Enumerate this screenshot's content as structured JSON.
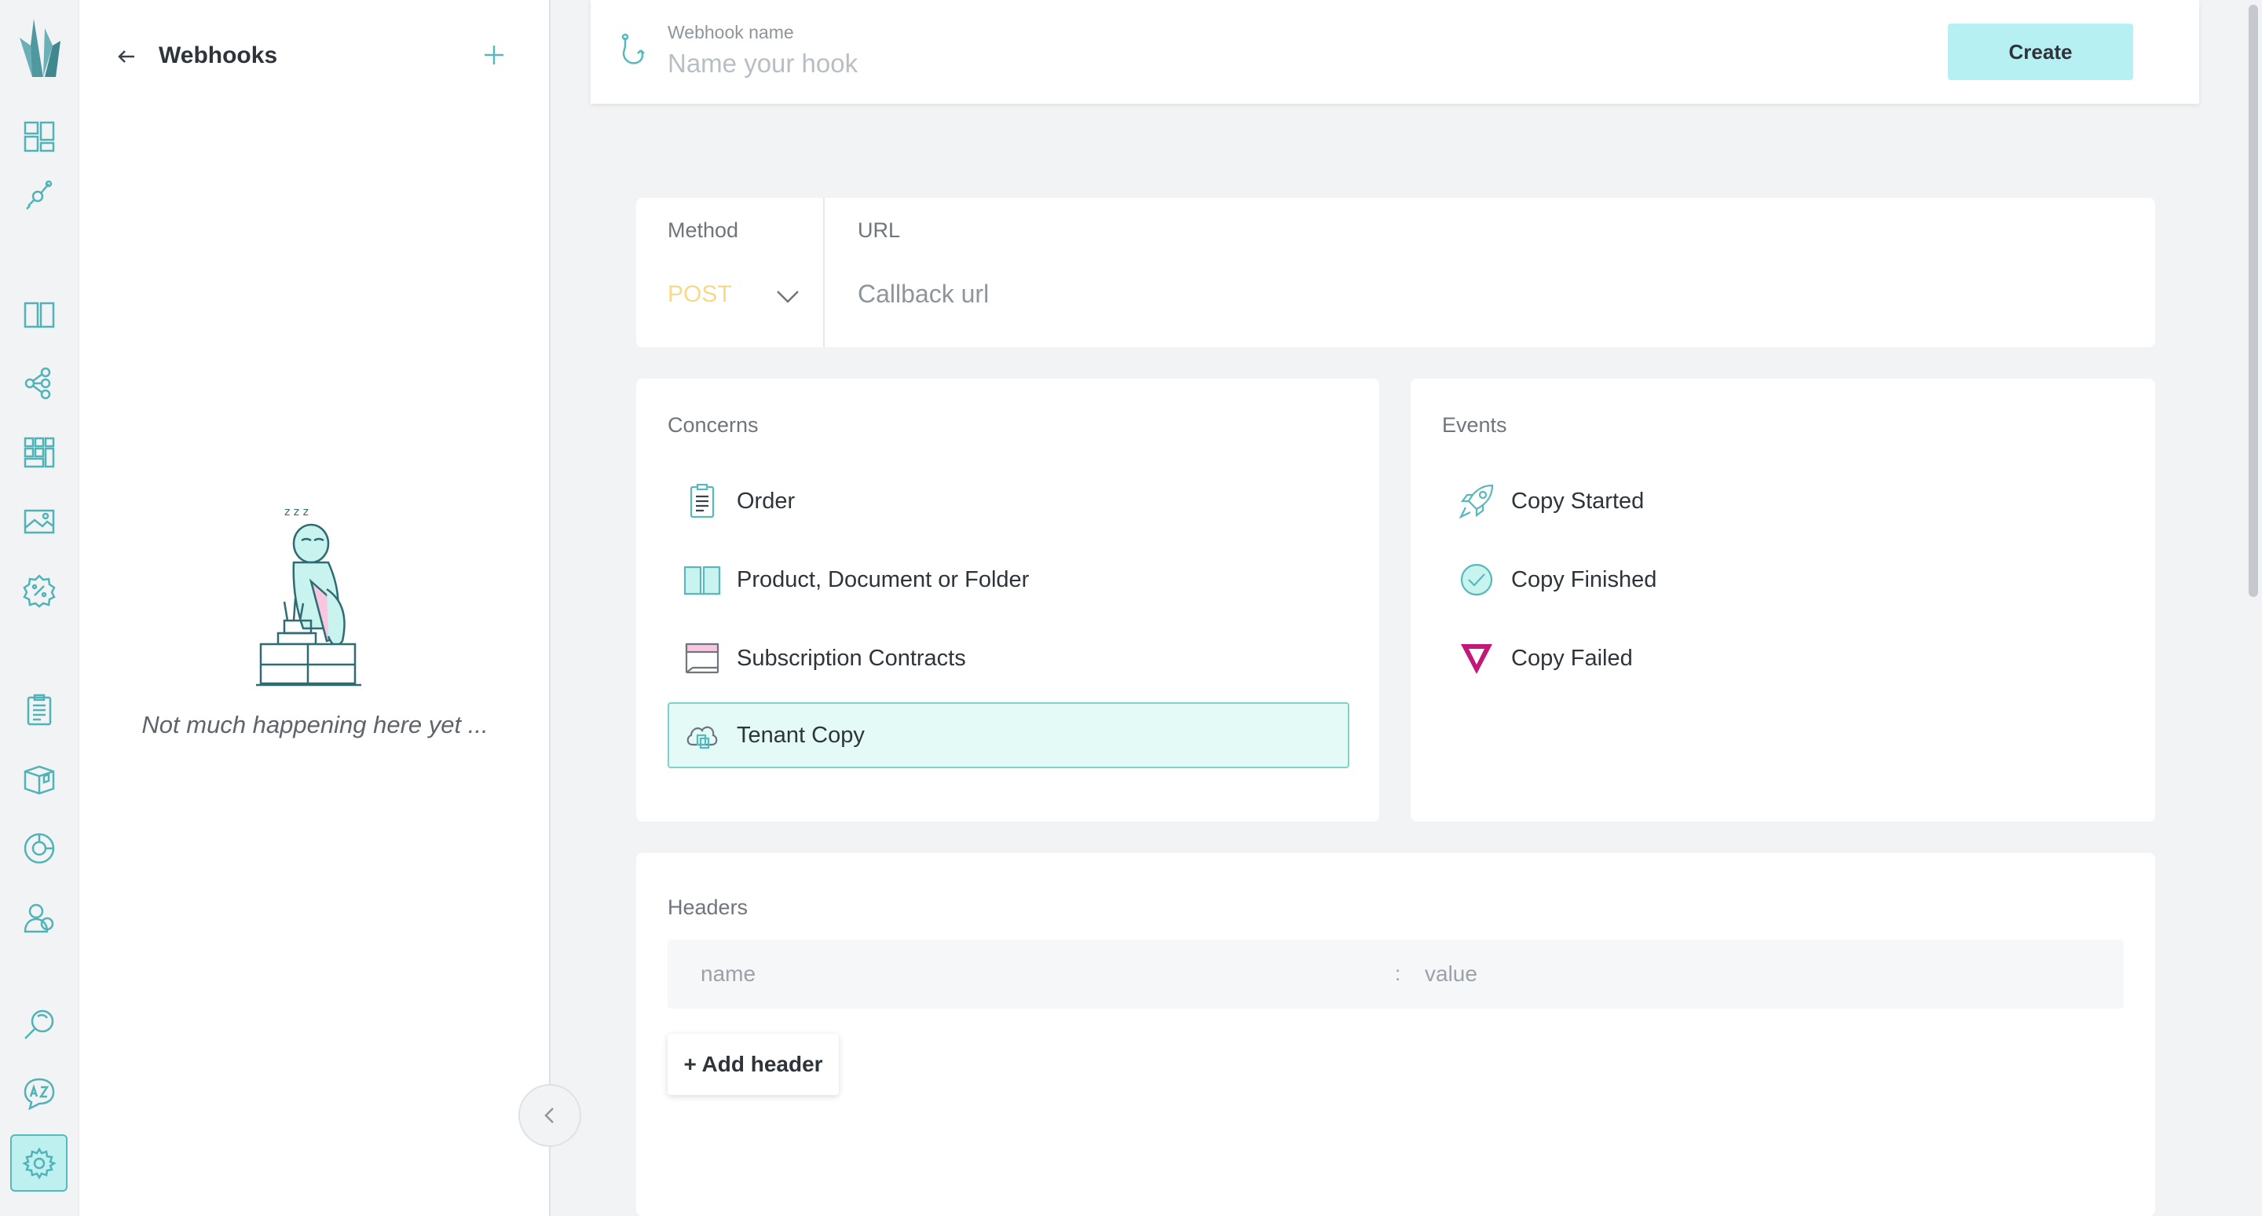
{
  "sidebar_nav": {
    "items": [
      {
        "name": "dashboard-icon"
      },
      {
        "name": "integrations-icon"
      },
      {
        "name": "catalog-book-icon"
      },
      {
        "name": "hierarchy-icon"
      },
      {
        "name": "grid-modules-icon"
      },
      {
        "name": "media-image-icon"
      },
      {
        "name": "discount-percent-icon"
      },
      {
        "name": "orders-clipboard-icon"
      },
      {
        "name": "product-box-icon"
      },
      {
        "name": "analytics-pie-icon"
      },
      {
        "name": "users-icon"
      },
      {
        "name": "search-icon"
      },
      {
        "name": "translations-icon"
      },
      {
        "name": "settings-gear-icon",
        "active": true
      }
    ]
  },
  "panel": {
    "title": "Webhooks",
    "empty_text": "Not much happening here yet ..."
  },
  "namebar": {
    "label": "Webhook name",
    "placeholder": "Name your hook",
    "create_label": "Create"
  },
  "request": {
    "method_label": "Method",
    "method_value": "POST",
    "url_label": "URL",
    "url_placeholder": "Callback url"
  },
  "concerns": {
    "title": "Concerns",
    "items": [
      {
        "label": "Order",
        "icon": "clipboard-icon",
        "selected": false
      },
      {
        "label": "Product, Document or Folder",
        "icon": "book-icon",
        "selected": false
      },
      {
        "label": "Subscription Contracts",
        "icon": "calendar-icon",
        "selected": false
      },
      {
        "label": "Tenant Copy",
        "icon": "cloud-copy-icon",
        "selected": true
      }
    ]
  },
  "events": {
    "title": "Events",
    "items": [
      {
        "label": "Copy Started",
        "icon": "rocket-icon"
      },
      {
        "label": "Copy Finished",
        "icon": "check-circle-icon"
      },
      {
        "label": "Copy Failed",
        "icon": "failed-triangle-icon"
      }
    ]
  },
  "headers": {
    "title": "Headers",
    "name_placeholder": "name",
    "value_placeholder": "value",
    "separator": ":",
    "add_label": "+ Add header"
  },
  "colors": {
    "accent": "#56b9bd",
    "accent_light": "#b7f0f2",
    "selected_bg": "#e3faf6",
    "method": "#f7d98a",
    "failed": "#c2187a"
  }
}
